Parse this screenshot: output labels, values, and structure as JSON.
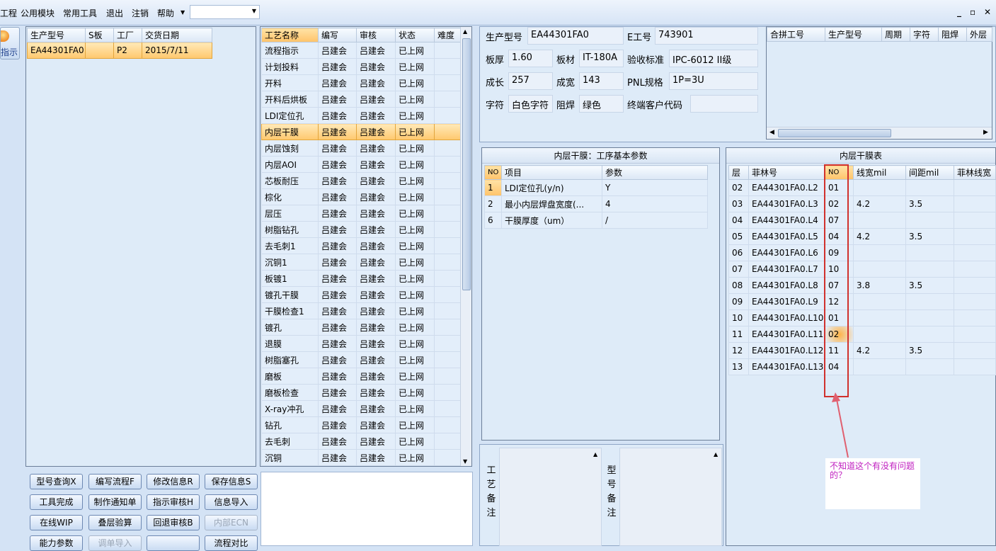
{
  "menu": {
    "items": [
      "工程",
      "公用模块",
      "常用工具",
      "退出",
      "注销",
      "帮助"
    ],
    "combo_value": ""
  },
  "side_button": {
    "label": "指示"
  },
  "order_grid": {
    "headers": [
      "生产型号",
      "S板",
      "工厂",
      "交货日期"
    ],
    "rows": [
      [
        "EA44301FA0",
        "",
        "P2",
        "2015/7/11"
      ]
    ]
  },
  "process_grid": {
    "headers": [
      "工艺名称",
      "编写",
      "审核",
      "状态",
      "难度"
    ],
    "selected_index": 5,
    "rows": [
      [
        "流程指示",
        "吕建会",
        "吕建会",
        "已上网"
      ],
      [
        "计划投料",
        "吕建会",
        "吕建会",
        "已上网"
      ],
      [
        "开料",
        "吕建会",
        "吕建会",
        "已上网"
      ],
      [
        "开料后烘板",
        "吕建会",
        "吕建会",
        "已上网"
      ],
      [
        "LDI定位孔",
        "吕建会",
        "吕建会",
        "已上网"
      ],
      [
        "内层干膜",
        "吕建会",
        "吕建会",
        "已上网"
      ],
      [
        "内层蚀刻",
        "吕建会",
        "吕建会",
        "已上网"
      ],
      [
        "内层AOI",
        "吕建会",
        "吕建会",
        "已上网"
      ],
      [
        "芯板耐压",
        "吕建会",
        "吕建会",
        "已上网"
      ],
      [
        "棕化",
        "吕建会",
        "吕建会",
        "已上网"
      ],
      [
        "层压",
        "吕建会",
        "吕建会",
        "已上网"
      ],
      [
        "树脂钻孔",
        "吕建会",
        "吕建会",
        "已上网"
      ],
      [
        "去毛刺1",
        "吕建会",
        "吕建会",
        "已上网"
      ],
      [
        "沉铜1",
        "吕建会",
        "吕建会",
        "已上网"
      ],
      [
        "板镀1",
        "吕建会",
        "吕建会",
        "已上网"
      ],
      [
        "镀孔干膜",
        "吕建会",
        "吕建会",
        "已上网"
      ],
      [
        "干膜检查1",
        "吕建会",
        "吕建会",
        "已上网"
      ],
      [
        "镀孔",
        "吕建会",
        "吕建会",
        "已上网"
      ],
      [
        "退膜",
        "吕建会",
        "吕建会",
        "已上网"
      ],
      [
        "树脂塞孔",
        "吕建会",
        "吕建会",
        "已上网"
      ],
      [
        "磨板",
        "吕建会",
        "吕建会",
        "已上网"
      ],
      [
        "磨板检查",
        "吕建会",
        "吕建会",
        "已上网"
      ],
      [
        "X-ray冲孔",
        "吕建会",
        "吕建会",
        "已上网"
      ],
      [
        "钻孔",
        "吕建会",
        "吕建会",
        "已上网"
      ],
      [
        "去毛刺",
        "吕建会",
        "吕建会",
        "已上网"
      ],
      [
        "沉铜",
        "吕建会",
        "吕建会",
        "已上网"
      ]
    ]
  },
  "buttons": [
    {
      "label": "型号查询X",
      "disabled": false
    },
    {
      "label": "编写流程F",
      "disabled": false
    },
    {
      "label": "修改信息R",
      "disabled": false
    },
    {
      "label": "保存信息S",
      "disabled": false
    },
    {
      "label": "工具完成",
      "disabled": false
    },
    {
      "label": "制作通知单",
      "disabled": false
    },
    {
      "label": "指示审核H",
      "disabled": false
    },
    {
      "label": "信息导入",
      "disabled": false
    },
    {
      "label": "在线WIP",
      "disabled": false
    },
    {
      "label": "叠层验算",
      "disabled": false
    },
    {
      "label": "回退审核B",
      "disabled": false
    },
    {
      "label": "内部ECN",
      "disabled": true
    },
    {
      "label": "能力参数",
      "disabled": false
    },
    {
      "label": "调单导入",
      "disabled": true
    },
    {
      "label": "",
      "disabled": false
    },
    {
      "label": "流程对比",
      "disabled": false
    }
  ],
  "info": {
    "model_label": "生产型号",
    "model": "EA44301FA0",
    "eno_label": "E工号",
    "eno": "743901",
    "thick_label": "板厚",
    "thick": "1.60",
    "mat_label": "板材",
    "mat": "IT-180A",
    "std_label": "验收标准",
    "std": "IPC-6012 II级",
    "len_label": "成长",
    "len": "257",
    "wid_label": "成宽",
    "wid": "143",
    "pnl_label": "PNL规格",
    "pnl": "1P=3U",
    "char_label": "字符",
    "char": "白色字符",
    "mask_label": "阻焊",
    "mask": "绿色",
    "cust_label": "终端客户代码",
    "cust": ""
  },
  "merge_grid": {
    "headers": [
      "合拼工号",
      "生产型号",
      "周期",
      "字符",
      "阻焊",
      "外层"
    ]
  },
  "param_panel": {
    "title": "内层干膜：工序基本参数",
    "headers": [
      "NO",
      "项目",
      "参数"
    ],
    "rows": [
      [
        "1",
        "LDI定位孔(y/n)",
        "Y"
      ],
      [
        "2",
        "最小内层焊盘宽度(...",
        "4"
      ],
      [
        "6",
        "干膜厚度（um）",
        "/"
      ]
    ]
  },
  "film_panel": {
    "title": "内层干膜表",
    "headers": [
      "层",
      "菲林号",
      "NO",
      "线宽mil",
      "间距mil",
      "菲林线宽"
    ],
    "rows": [
      [
        "02",
        "EA44301FA0.L2",
        "01",
        "",
        ""
      ],
      [
        "03",
        "EA44301FA0.L3",
        "02",
        "4.2",
        "3.5"
      ],
      [
        "04",
        "EA44301FA0.L4",
        "07",
        "",
        ""
      ],
      [
        "05",
        "EA44301FA0.L5",
        "04",
        "4.2",
        "3.5"
      ],
      [
        "06",
        "EA44301FA0.L6",
        "09",
        "",
        ""
      ],
      [
        "07",
        "EA44301FA0.L7",
        "10",
        "",
        ""
      ],
      [
        "08",
        "EA44301FA0.L8",
        "07",
        "3.8",
        "3.5"
      ],
      [
        "09",
        "EA44301FA0.L9",
        "12",
        "",
        ""
      ],
      [
        "10",
        "EA44301FA0.L10",
        "01",
        "",
        ""
      ],
      [
        "11",
        "EA44301FA0.L11",
        "02",
        "",
        ""
      ],
      [
        "12",
        "EA44301FA0.L12",
        "11",
        "4.2",
        "3.5"
      ],
      [
        "13",
        "EA44301FA0.L13",
        "04",
        "",
        ""
      ]
    ],
    "highlight_row": 9
  },
  "remarks": {
    "process_label": "工艺备注",
    "model_label": "型号备注"
  },
  "annotation": {
    "text": "不知道这个有没有问题的？",
    "box_color": "#d0312d",
    "arrow_color": "#e06070",
    "text_color": "#c020c0"
  }
}
